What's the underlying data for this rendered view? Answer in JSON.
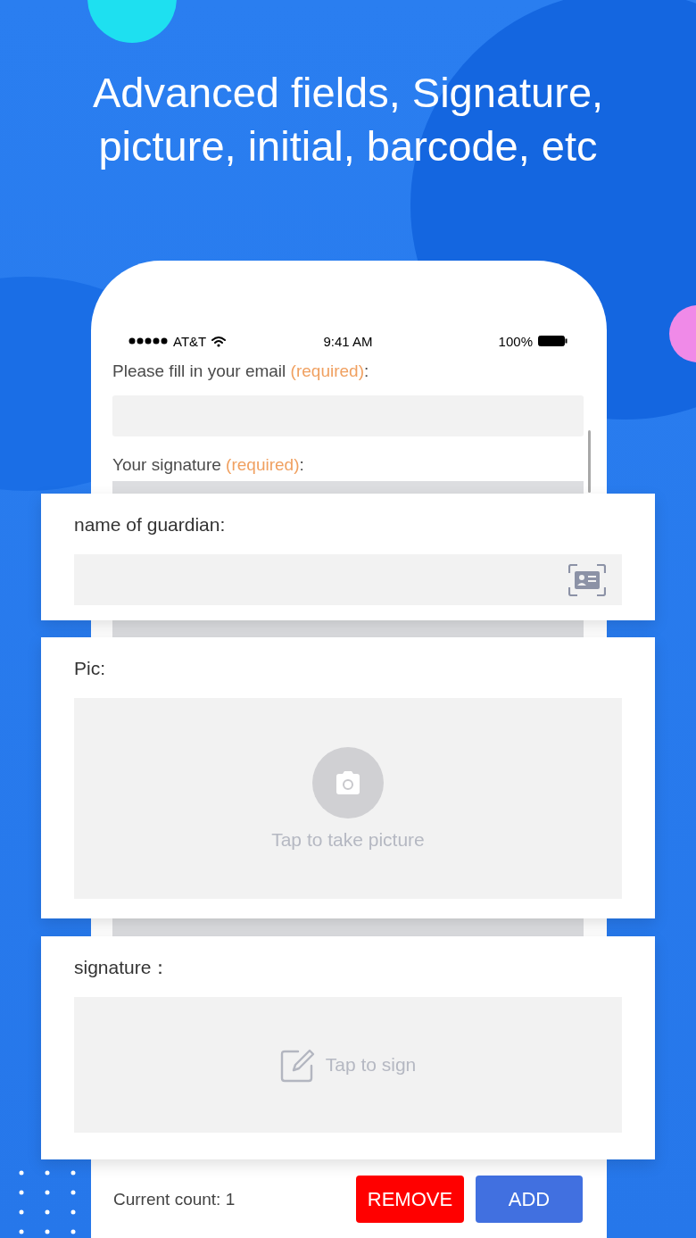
{
  "headline": "Advanced fields, Signature, picture, initial, barcode, etc",
  "status_bar": {
    "carrier": "AT&T",
    "time": "9:41 AM",
    "battery": "100%"
  },
  "form_fields": [
    {
      "label": "Please fill in your email ",
      "required_note": "(required)",
      "suffix": ":"
    },
    {
      "label": "Your signature ",
      "required_note": "(required)",
      "suffix": ":"
    }
  ],
  "cards": [
    {
      "kind": "scan",
      "label": "name of guardian:"
    },
    {
      "kind": "photo",
      "label": "Pic:",
      "hint": "Tap to take picture"
    },
    {
      "kind": "sign",
      "label": "signature：",
      "hint": "Tap to sign"
    }
  ],
  "footer": {
    "count_text": "Current count: 1",
    "buttons": [
      {
        "kind": "remove",
        "label": "REMOVE"
      },
      {
        "kind": "add",
        "label": "ADD"
      }
    ]
  }
}
